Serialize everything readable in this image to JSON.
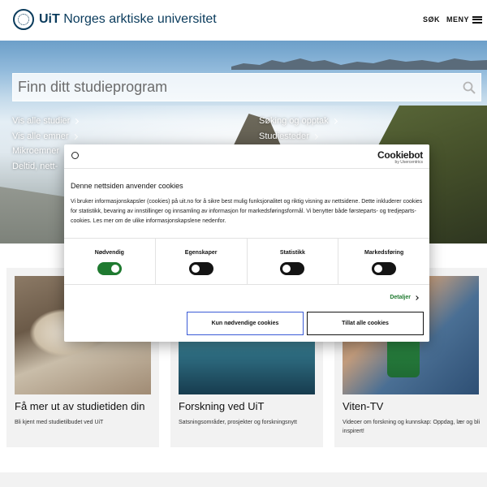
{
  "header": {
    "logo_strong": "UiT",
    "logo_rest": " Norges arktiske universitet",
    "search_label": "SØK",
    "menu_label": "MENY"
  },
  "hero": {
    "search_placeholder": "Finn ditt studieprogram",
    "links_left": [
      "Vis alle studier",
      "Vis alle emner",
      "Mikroemner",
      "Deltid, nett-"
    ],
    "links_right": [
      "Søking og opptak",
      "Studiesteder"
    ]
  },
  "cards": [
    {
      "title": "Få mer ut av studietiden din",
      "description": "Bli kjent med studietilbudet ved UiT"
    },
    {
      "title": "Forskning ved UiT",
      "description": "Satsningsområder, prosjekter og forskningsnytt"
    },
    {
      "title": "Viten-TV",
      "description": "Videoer om forskning og kunnskap: Oppdag, lær og bli inspirert!"
    }
  ],
  "cookie": {
    "brand_name": "Cookiebot",
    "brand_sub": "by Usercentrics",
    "title": "Denne nettsiden anvender cookies",
    "body": "Vi bruker informasjonskapsler (cookies) på uit.no for å sikre best mulig funksjonalitet og riktig visning av nettsidene. Dette inkluderer cookies for statistikk, bevaring av innstillinger og innsamling av informasjon for markedsføringsformål. Vi benytter både førsteparts- og tredjeparts-cookies. Les mer om de ulike informasjonskapslene nedenfor.",
    "categories": [
      {
        "label": "Nødvendig",
        "enabled": true
      },
      {
        "label": "Egenskaper",
        "enabled": false
      },
      {
        "label": "Statistikk",
        "enabled": false
      },
      {
        "label": "Markedsføring",
        "enabled": false
      }
    ],
    "details_label": "Detaljer",
    "btn_necessary": "Kun nødvendige cookies",
    "btn_all": "Tillat alle cookies"
  },
  "colors": {
    "brand_blue": "#0a3b5c",
    "toggle_on": "#1f7a30",
    "button_focus": "#3b5bd6"
  }
}
